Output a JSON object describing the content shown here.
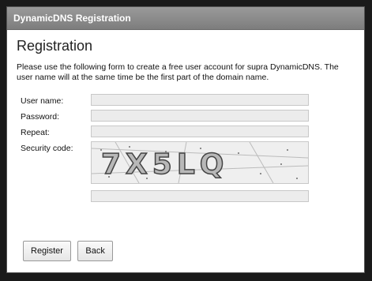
{
  "window": {
    "title": "DynamicDNS Registration"
  },
  "form": {
    "heading": "Registration",
    "intro": "Please use the following form to create a free user account for supra DynamicDNS. The user name will at the same time be the first part of the domain name.",
    "fields": {
      "username_label": "User name:",
      "username_value": "",
      "password_label": "Password:",
      "password_value": "",
      "repeat_label": "Repeat:",
      "repeat_value": "",
      "security_label": "Security code:",
      "security_code_image_text": "7X5LQ",
      "security_code_value": ""
    }
  },
  "buttons": {
    "register": "Register",
    "back": "Back"
  }
}
